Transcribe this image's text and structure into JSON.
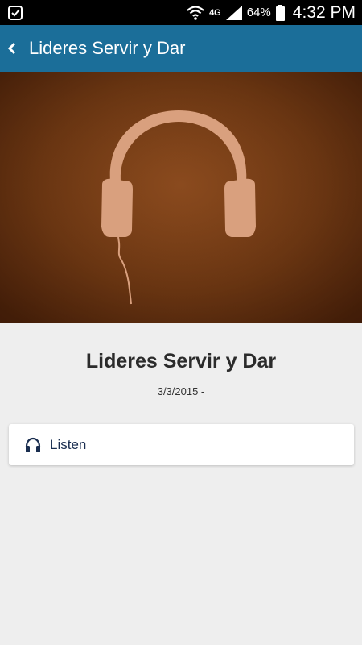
{
  "status_bar": {
    "left_icon": "check-icon",
    "network": "4G",
    "battery_percent": "64%",
    "time": "4:32 PM"
  },
  "app_bar": {
    "back_icon": "chevron-left-icon",
    "title": "Lideres Servir y Dar"
  },
  "hero": {
    "icon": "headphones-icon",
    "colors": {
      "background": "#6e3812",
      "icon": "#d9a07e"
    }
  },
  "content": {
    "title": "Lideres Servir y Dar",
    "date": "3/3/2015 -"
  },
  "actions": {
    "listen": {
      "icon": "headphones-icon",
      "label": "Listen"
    }
  },
  "colors": {
    "app_bar": "#1b6e99",
    "background": "#eeeeee"
  }
}
